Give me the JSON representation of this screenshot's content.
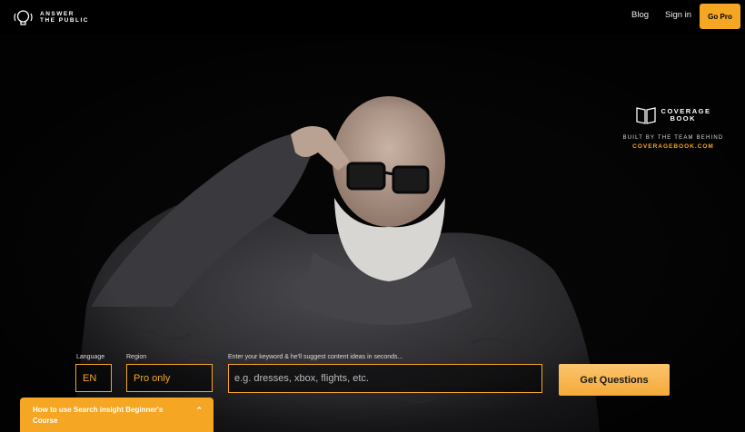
{
  "header": {
    "logo_line1": "ANSWER",
    "logo_line2": "THE PUBLIC",
    "blog": "Blog",
    "signin": "Sign in",
    "go_pro": "Go Pro"
  },
  "coverage": {
    "title_line1": "COVERAGE",
    "title_line2": "BOOK",
    "built_by": "BUILT BY THE TEAM BEHIND",
    "link": "COVERAGEBOOK.COM"
  },
  "search": {
    "language_label": "Language",
    "language_value": "EN",
    "region_label": "Region",
    "region_value": "Pro only",
    "keyword_label": "Enter your keyword & he'll suggest content ideas in seconds...",
    "keyword_placeholder": "e.g. dresses, xbox, flights, etc.",
    "submit": "Get Questions"
  },
  "course_banner": {
    "text": "How to use Search insight Beginner's Course"
  },
  "colors": {
    "accent": "#f5a623",
    "background": "#000000"
  },
  "icons": {
    "logo": "lightbulb-head-icon",
    "book": "book-icon",
    "collapse": "chevron-up-icon"
  }
}
